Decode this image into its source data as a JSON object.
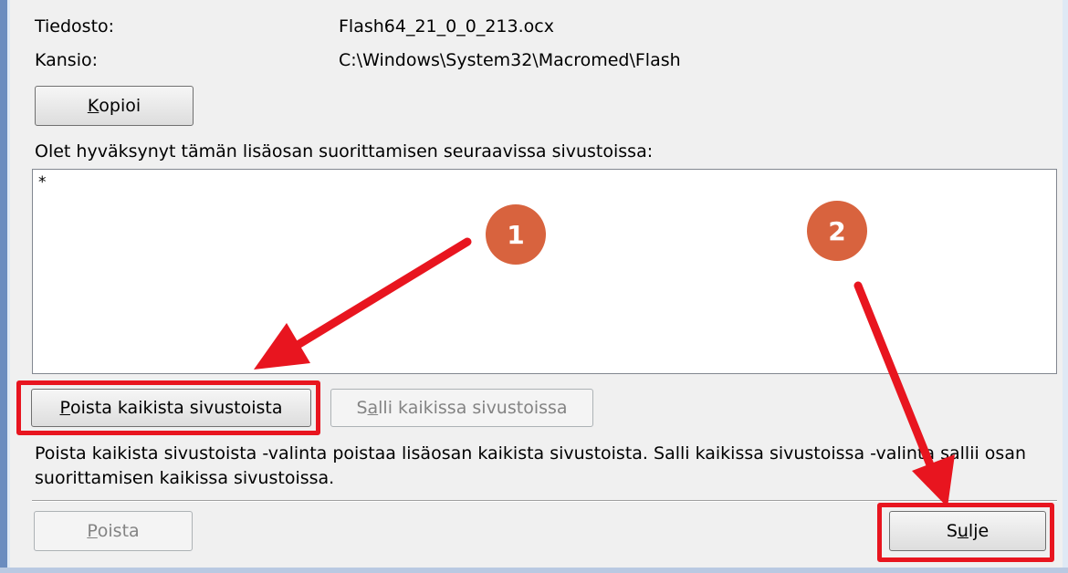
{
  "details": {
    "file_label": "Tiedosto:",
    "file_value": "Flash64_21_0_0_213.ocx",
    "folder_label": "Kansio:",
    "folder_value": "C:\\Windows\\System32\\Macromed\\Flash"
  },
  "copy_button": {
    "mnemonic": "K",
    "rest": "opioi"
  },
  "sites": {
    "heading": "Olet hyväksynyt tämän lisäosan suorittamisen seuraavissa sivustoissa:",
    "items": [
      "*"
    ]
  },
  "remove_all_button": {
    "mnemonic": "P",
    "rest": "oista kaikista sivustoista"
  },
  "allow_all_button": {
    "pre": "S",
    "mnemonic": "a",
    "rest": "lli kaikissa sivustoissa"
  },
  "description": "Poista kaikista sivustoista -valinta poistaa lisäosan kaikista sivustoista. Salli kaikissa sivustoissa -valinta sallii osan suorittamisen kaikissa sivustoissa.",
  "remove_button": {
    "mnemonic": "P",
    "rest": "oista"
  },
  "close_button": {
    "pre": "S",
    "mnemonic": "u",
    "rest": "lje"
  },
  "annotations": {
    "badge_1": "1",
    "badge_2": "2"
  },
  "colors": {
    "highlight": "#e8151f",
    "badge": "#d8633e",
    "dialog_bg": "#f0f0f0"
  }
}
